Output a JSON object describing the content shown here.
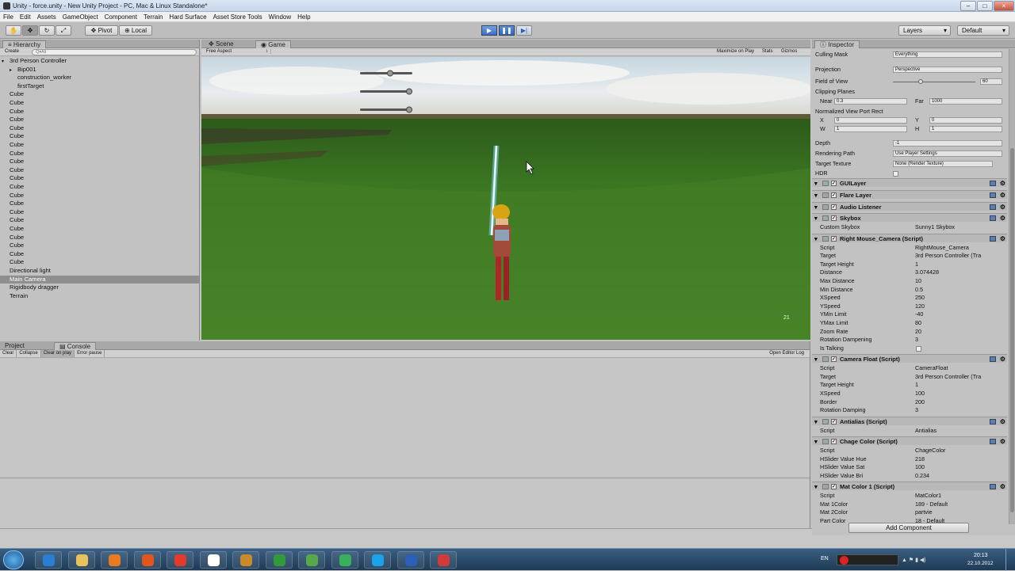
{
  "window": {
    "title": "Unity - force.unity - New Unity Project - PC, Mac & Linux Standalone*",
    "min": "–",
    "max": "□",
    "close": "×"
  },
  "menu": [
    "File",
    "Edit",
    "Assets",
    "GameObject",
    "Component",
    "Terrain",
    "Hard Surface",
    "Asset Store Tools",
    "Window",
    "Help"
  ],
  "toolbar": {
    "pivot": "Pivot",
    "local": "Local",
    "layers": "Layers",
    "layout": "Default"
  },
  "hierarchy": {
    "tab": "Hierarchy",
    "create": "Create",
    "search_placeholder": "Q▾All",
    "items": [
      {
        "label": "3rd Person Controller",
        "indent": 0,
        "arrow": "▾"
      },
      {
        "label": "Bip001",
        "indent": 1,
        "arrow": "▸"
      },
      {
        "label": "construction_worker",
        "indent": 1,
        "arrow": ""
      },
      {
        "label": "firstTarget",
        "indent": 1,
        "arrow": ""
      },
      {
        "label": "Cube",
        "indent": 0,
        "arrow": ""
      },
      {
        "label": "Cube",
        "indent": 0,
        "arrow": ""
      },
      {
        "label": "Cube",
        "indent": 0,
        "arrow": ""
      },
      {
        "label": "Cube",
        "indent": 0,
        "arrow": ""
      },
      {
        "label": "Cube",
        "indent": 0,
        "arrow": ""
      },
      {
        "label": "Cube",
        "indent": 0,
        "arrow": ""
      },
      {
        "label": "Cube",
        "indent": 0,
        "arrow": ""
      },
      {
        "label": "Cube",
        "indent": 0,
        "arrow": ""
      },
      {
        "label": "Cube",
        "indent": 0,
        "arrow": ""
      },
      {
        "label": "Cube",
        "indent": 0,
        "arrow": ""
      },
      {
        "label": "Cube",
        "indent": 0,
        "arrow": ""
      },
      {
        "label": "Cube",
        "indent": 0,
        "arrow": ""
      },
      {
        "label": "Cube",
        "indent": 0,
        "arrow": ""
      },
      {
        "label": "Cube",
        "indent": 0,
        "arrow": ""
      },
      {
        "label": "Cube",
        "indent": 0,
        "arrow": ""
      },
      {
        "label": "Cube",
        "indent": 0,
        "arrow": ""
      },
      {
        "label": "Cube",
        "indent": 0,
        "arrow": ""
      },
      {
        "label": "Cube",
        "indent": 0,
        "arrow": ""
      },
      {
        "label": "Cube",
        "indent": 0,
        "arrow": ""
      },
      {
        "label": "Cube",
        "indent": 0,
        "arrow": ""
      },
      {
        "label": "Cube",
        "indent": 0,
        "arrow": ""
      },
      {
        "label": "Directional light",
        "indent": 0,
        "arrow": ""
      },
      {
        "label": "Main Camera",
        "indent": 0,
        "arrow": "",
        "selected": true
      },
      {
        "label": "Rigidbody dragger",
        "indent": 0,
        "arrow": ""
      },
      {
        "label": "Terrain",
        "indent": 0,
        "arrow": ""
      }
    ]
  },
  "scene_tabs": {
    "scene": "Scene",
    "game": "Game",
    "aspect": "Free Aspect",
    "maximize": "Maximize on Play",
    "stats": "Stats",
    "gizmos": "Gizmos",
    "corner_number": "21"
  },
  "bottom": {
    "project_tab": "Project",
    "console_tab": "Console",
    "clear": "Clear",
    "collapse": "Collapse",
    "clear_on_play": "Clear on play",
    "error_pause": "Error pause",
    "open_log": "Open Editor Log"
  },
  "inspector": {
    "tab": "Inspector",
    "camera_rows": [
      {
        "label": "Culling Mask",
        "value": "Everything",
        "kind": "dropdown"
      },
      {
        "label": "Projection",
        "value": "Perspective",
        "kind": "dropdown"
      },
      {
        "label": "Field of View",
        "value": "60",
        "kind": "slider"
      },
      {
        "label": "Clipping Planes",
        "value": "",
        "kind": "label"
      }
    ],
    "near_label": "Near",
    "near": "0.3",
    "far_label": "Far",
    "far": "1000",
    "viewport_label": "Normalized View Port Rect",
    "x_label": "X",
    "x": "0",
    "y_label": "Y",
    "y": "0",
    "w_label": "W",
    "w": "1",
    "h_label": "H",
    "h": "1",
    "depth_label": "Depth",
    "depth": "-1",
    "rendering_label": "Rendering Path",
    "rendering": "Use Player Settings",
    "target_tex_label": "Target Texture",
    "target_tex": "None (Render Texture)",
    "hdr_label": "HDR",
    "components": [
      {
        "title": "GUILayer"
      },
      {
        "title": "Flare Layer"
      },
      {
        "title": "Audio Listener"
      },
      {
        "title": "Skybox",
        "rows": [
          {
            "label": "Custom Skybox",
            "value": "Sunny1 Skybox"
          }
        ]
      },
      {
        "title": "Right Mouse_Camera (Script)",
        "rows": [
          {
            "label": "Script",
            "value": "RightMouse_Camera"
          },
          {
            "label": "Target",
            "value": "3rd Person Controller (Tra"
          },
          {
            "label": "Target Height",
            "value": "1"
          },
          {
            "label": "Distance",
            "value": "3.074428"
          },
          {
            "label": "Max Distance",
            "value": "10"
          },
          {
            "label": "Min Distance",
            "value": "0.5"
          },
          {
            "label": "XSpeed",
            "value": "250"
          },
          {
            "label": "YSpeed",
            "value": "120"
          },
          {
            "label": "YMin Limit",
            "value": "-40"
          },
          {
            "label": "YMax Limit",
            "value": "80"
          },
          {
            "label": "Zoom Rate",
            "value": "20"
          },
          {
            "label": "Rotation Dampening",
            "value": "3"
          },
          {
            "label": "Is Talking",
            "value": ""
          }
        ]
      },
      {
        "title": "Camera Float (Script)",
        "rows": [
          {
            "label": "Script",
            "value": "CameraFloat"
          },
          {
            "label": "Target",
            "value": "3rd Person Controller (Tra"
          },
          {
            "label": "Target Height",
            "value": "1"
          },
          {
            "label": "XSpeed",
            "value": "100"
          },
          {
            "label": "Border",
            "value": "200"
          },
          {
            "label": "Rotation Damping",
            "value": "3"
          }
        ]
      },
      {
        "title": "Antialias (Script)",
        "rows": [
          {
            "label": "Script",
            "value": "Antialias"
          }
        ]
      },
      {
        "title": "Chage Color (Script)",
        "rows": [
          {
            "label": "Script",
            "value": "ChageColor"
          },
          {
            "label": "HSlider Value Hue",
            "value": "218"
          },
          {
            "label": "HSlider Value Sat",
            "value": "100"
          },
          {
            "label": "HSlider Value Bri",
            "value": "0.234"
          }
        ]
      },
      {
        "title": "Mat Color 1 (Script)",
        "rows": [
          {
            "label": "Script",
            "value": "MatColor1"
          },
          {
            "label": "Mat 1Color",
            "value": "189 - Default"
          },
          {
            "label": "Mat 2Color",
            "value": "partvie"
          },
          {
            "label": "Part Color",
            "value": "18 - Default"
          }
        ]
      }
    ],
    "add_component": "Add Component"
  },
  "taskbar": {
    "lang": "EN",
    "time": "20:13",
    "date": "22.10.2012"
  },
  "colors": {
    "accent": "#3c6fc4",
    "selection": "#8e8e8e",
    "sky": "#dfe8ee",
    "grass": "#3f7a22"
  },
  "icons": [
    "windows-start-icon",
    "ie-icon",
    "explorer-icon",
    "media-icon",
    "firefox-icon",
    "chrome-icon",
    "unity-icon",
    "folder-icon",
    "utorrent-icon",
    "plant-icon",
    "app-icon",
    "skype-icon",
    "word-icon",
    "record-icon"
  ]
}
